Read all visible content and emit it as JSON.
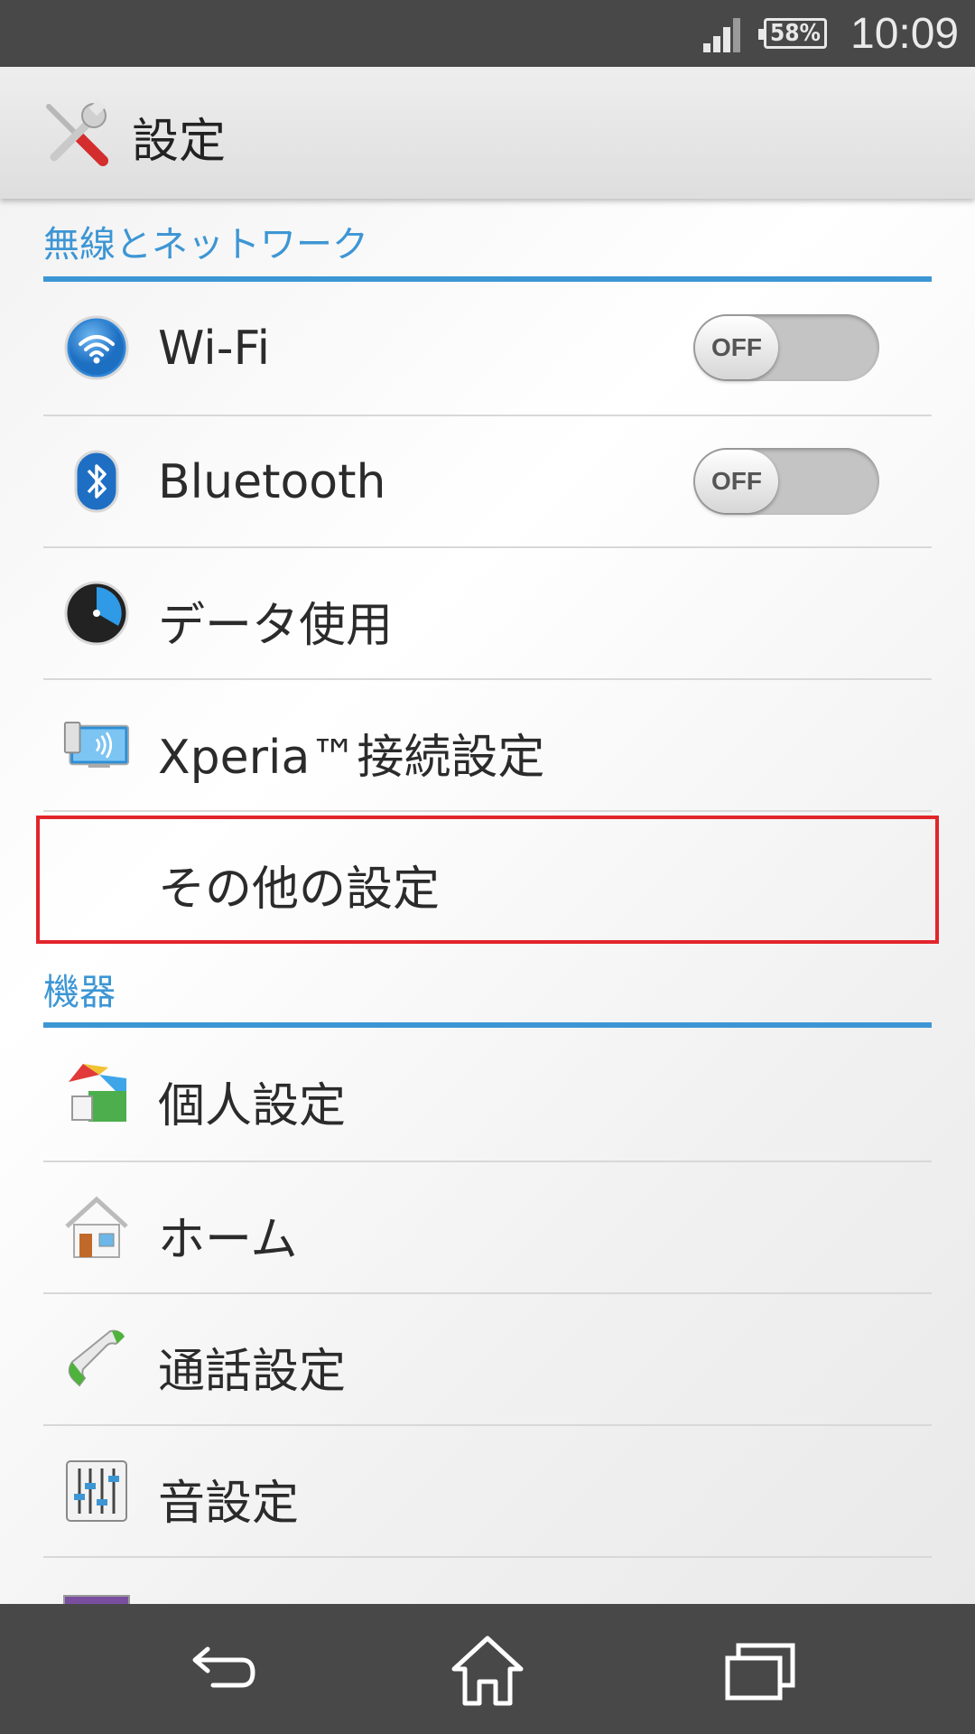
{
  "status_bar": {
    "battery": "58%",
    "time": "10:09",
    "icons": [
      "signal-icon",
      "battery-icon"
    ]
  },
  "action_bar": {
    "title": "設定",
    "icon": "settings-tools-icon"
  },
  "sections": [
    {
      "header": "無線とネットワーク",
      "items": [
        {
          "label": "Wi-Fi",
          "icon": "wifi-icon",
          "toggle": "OFF"
        },
        {
          "label": "Bluetooth",
          "icon": "bluetooth-icon",
          "toggle": "OFF"
        },
        {
          "label": "データ使用",
          "icon": "data-usage-icon"
        },
        {
          "label": "Xperia™接続設定",
          "icon": "xperia-connectivity-icon"
        },
        {
          "label": "その他の設定",
          "icon": ""
        }
      ]
    },
    {
      "header": "機器",
      "items": [
        {
          "label": "個人設定",
          "icon": "personalization-icon"
        },
        {
          "label": "ホーム",
          "icon": "home-house-icon"
        },
        {
          "label": "通話設定",
          "icon": "phone-handset-icon"
        },
        {
          "label": "音設定",
          "icon": "sound-equalizer-icon"
        }
      ]
    }
  ],
  "colors": {
    "accent": "#3d96d4",
    "highlight": "#e2242b",
    "bars": "#484848"
  },
  "nav_bar": {
    "icons": [
      "back-icon",
      "home-icon",
      "recent-apps-icon"
    ]
  }
}
